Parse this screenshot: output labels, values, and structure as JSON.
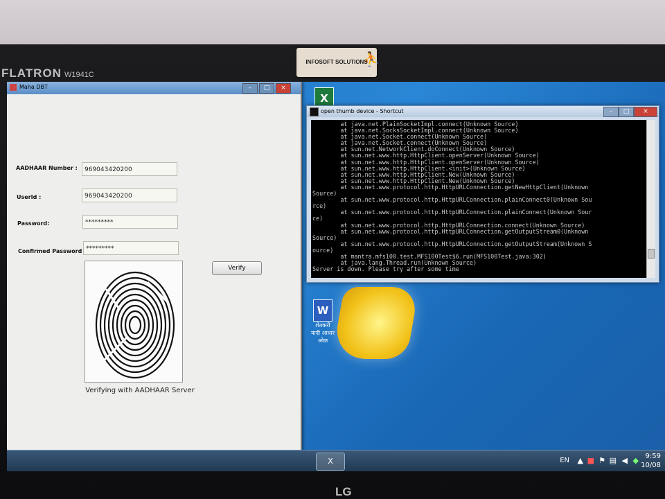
{
  "monitor": {
    "brand": "FLATRON",
    "model": "W1941C",
    "sticker": "INFOSOFT SOLUTIONS",
    "maker_logo": "LG"
  },
  "app": {
    "title": "Maha DBT",
    "fields": [
      {
        "label": "AADHAAR Number :",
        "value": "969043420200"
      },
      {
        "label": "UserId :",
        "value": "969043420200"
      },
      {
        "label": "Password:",
        "value": "*********"
      },
      {
        "label": "Confirmed Password",
        "value": "*********"
      }
    ],
    "verify_button": "Verify",
    "status": "Verifying with AADHAAR Server"
  },
  "console": {
    "title": "open thumb device - Shortcut",
    "lines": [
      "        at java.net.PlainSocketImpl.connect(Unknown Source)",
      "        at java.net.SocksSocketImpl.connect(Unknown Source)",
      "        at java.net.Socket.connect(Unknown Source)",
      "        at java.net.Socket.connect(Unknown Source)",
      "        at sun.net.NetworkClient.doConnect(Unknown Source)",
      "        at sun.net.www.http.HttpClient.openServer(Unknown Source)",
      "        at sun.net.www.http.HttpClient.openServer(Unknown Source)",
      "        at sun.net.www.http.HttpClient.<init>(Unknown Source)",
      "        at sun.net.www.http.HttpClient.New(Unknown Source)",
      "        at sun.net.www.http.HttpClient.New(Unknown Source)",
      "        at sun.net.www.protocol.http.HttpURLConnection.getNewHttpClient(Unknown",
      "Source)",
      "        at sun.net.www.protocol.http.HttpURLConnection.plainConnect0(Unknown Sou",
      "rce)",
      "        at sun.net.www.protocol.http.HttpURLConnection.plainConnect(Unknown Sour",
      "ce)",
      "        at sun.net.www.protocol.http.HttpURLConnection.connect(Unknown Source)",
      "        at sun.net.www.protocol.http.HttpURLConnection.getOutputStream0(Unknown",
      "Source)",
      "        at sun.net.www.protocol.http.HttpURLConnection.getOutputStream(Unknown S",
      "ource)",
      "        at mantra.mfs100.test.MFS100Test$6.run(MFS100Test.java:302)",
      "        at java.lang.Thread.run(Unknown Source)",
      "Server is down. Please try after some time"
    ]
  },
  "taskbar": {
    "language": "EN",
    "time": "9:59",
    "date": "10/08"
  },
  "desktop_icons": [
    {
      "kind": "excel-icon",
      "label": ""
    },
    {
      "kind": "word-icon",
      "label": "शेतकरी यादी आधार ओळ"
    }
  ]
}
